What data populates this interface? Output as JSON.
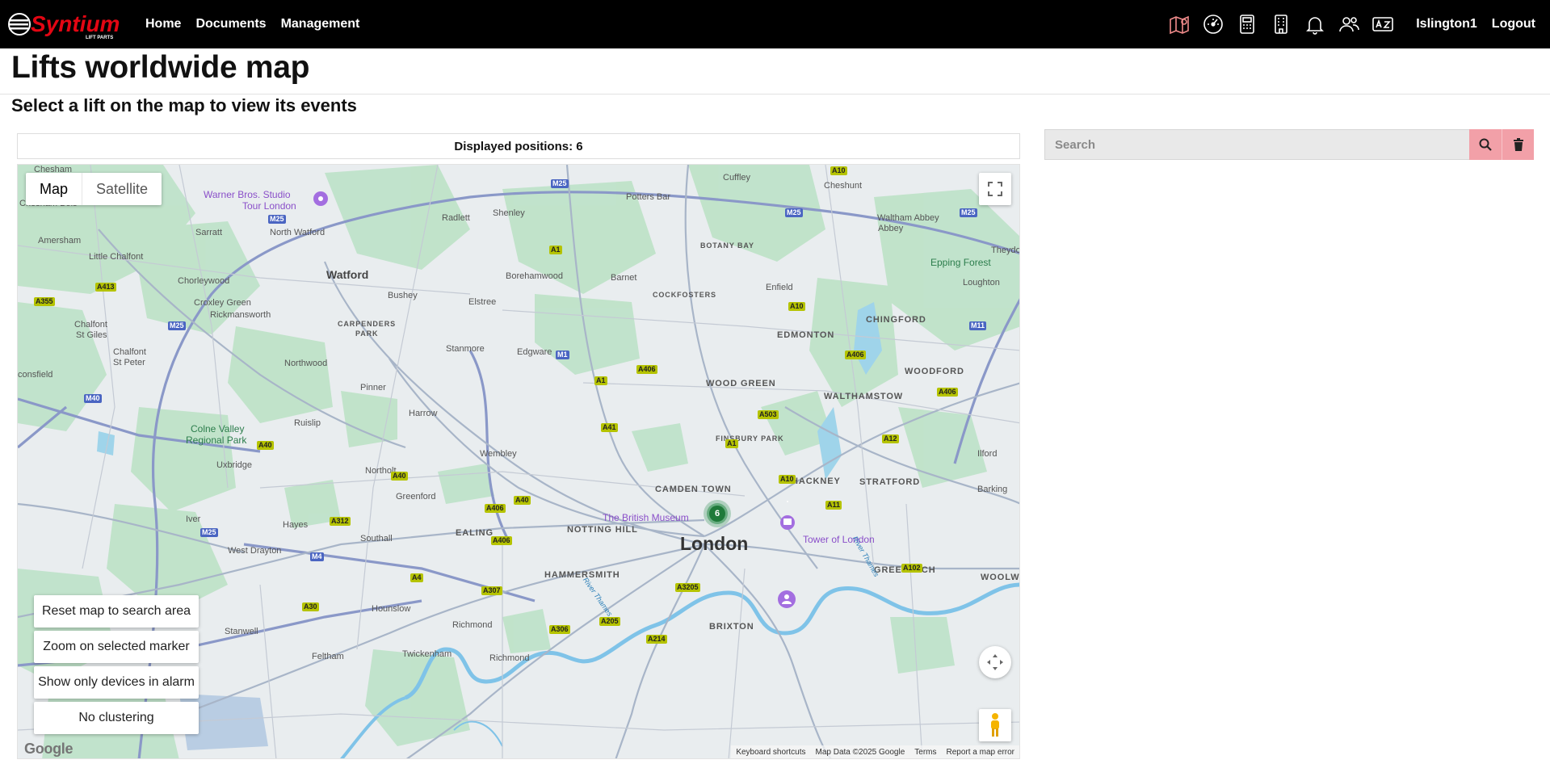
{
  "brand": {
    "name": "Syntium",
    "tagline": "LIFT PARTS",
    "accent": "#e30613"
  },
  "nav": {
    "links": [
      "Home",
      "Documents",
      "Management"
    ],
    "icons": [
      "map-icon",
      "dashboard-icon",
      "calculator-icon",
      "building-icon",
      "bell-icon",
      "users-icon",
      "language-icon"
    ],
    "user": "Islington1",
    "logout": "Logout"
  },
  "page": {
    "title": "Lifts worldwide map",
    "subtitle": "Select a lift on the map to view its events"
  },
  "map": {
    "positions_label": "Displayed positions: 6",
    "type_map": "Map",
    "type_satellite": "Satellite",
    "buttons": {
      "reset": "Reset map to search area",
      "zoom": "Zoom on selected marker",
      "alarm": "Show only devices in alarm",
      "clustering": "No clustering"
    },
    "cluster_count": "6",
    "google": "Google",
    "attribution": {
      "shortcuts": "Keyboard shortcuts",
      "data": "Map Data ©2025 Google",
      "terms": "Terms",
      "report": "Report a map error"
    },
    "labels": {
      "chesham": "Chesham",
      "chesham_bois": "Chesham Bois",
      "warner": "Warner Bros. Studio",
      "warner2": "Tour London",
      "sarratt": "Sarratt",
      "amersham": "Amersham",
      "little_chalfont": "Little Chalfont",
      "chorleywood": "Chorleywood",
      "croxley": "Croxley Green",
      "rickmansworth": "Rickmansworth",
      "chalfont_giles": "Chalfont\nSt Giles",
      "chalfont_peter": "Chalfont\nSt Peter",
      "consfield": "consfield",
      "north_watford": "North Watford",
      "watford": "Watford",
      "radlett": "Radlett",
      "shenley": "Shenley",
      "potters_bar": "Potters Bar",
      "cuffley": "Cuffley",
      "cheshunt": "Cheshunt",
      "waltham_abbey": "Waltham\nAbbey",
      "theydon": "Theydo",
      "botany_bay": "BOTANY BAY",
      "epping_forest": "Epping Forest",
      "loughton": "Loughton",
      "borehamwood": "Borehamwood",
      "barnet": "Barnet",
      "cockfosters": "COCKFOSTERS",
      "enfield": "Enfield",
      "bushey": "Bushey",
      "elstree": "Elstree",
      "carpenders": "CARPENDERS\nPARK",
      "edmonton": "EDMONTON",
      "chingford": "CHINGFORD",
      "stanmore": "Stanmore",
      "edgware": "Edgware",
      "northwood": "Northwood",
      "woodford": "WOODFORD",
      "wood_green": "WOOD GREEN",
      "walthamstow": "WALTHAMSTOW",
      "pinner": "Pinner",
      "harrow": "Harrow",
      "ruislip": "Ruislip",
      "colne_valley": "Colne Valley\nRegional Park",
      "finsbury_park": "FINSBURY PARK",
      "wembley": "Wembley",
      "ilford": "Ilford",
      "uxbridge": "Uxbridge",
      "northolt": "Northolt",
      "hackney": "HACKNEY",
      "stratford": "STRATFORD",
      "camden": "CAMDEN TOWN",
      "barking": "Barking",
      "greenford": "Greenford",
      "british_museum": "The British Museum",
      "iver": "Iver",
      "hayes": "Hayes",
      "ealing": "EALING",
      "notting_hill": "NOTTING HILL",
      "tower": "Tower of London",
      "southall": "Southall",
      "london": "London",
      "west_drayton": "West Drayton",
      "greenwich": "GREENWICH",
      "woolwich": "WOOLWICH",
      "hammersmith": "HAMMERSMITH",
      "hounslow": "Hounslow",
      "richmond": "Richmond",
      "brixton": "BRIXTON",
      "stanwell": "Stanwell",
      "twickenham": "Twickenham",
      "feltham": "Feltham",
      "richmond2": "Richmond",
      "thames": "River Thames",
      "thames2": "River Thames"
    },
    "roads": {
      "m25a": "M25",
      "m25b": "M25",
      "m25c": "M25",
      "m25d": "M25",
      "m25e": "M25",
      "m25f": "M25",
      "a10a": "A10",
      "a10b": "A10",
      "a10c": "A10",
      "a1a": "A1",
      "a1b": "A1",
      "a1c": "A1",
      "a413": "A413",
      "a355": "A355",
      "m11": "M11",
      "a406a": "A406",
      "a406b": "A406",
      "a406c": "A406",
      "a406d": "A406",
      "a406e": "A406",
      "m1": "M1",
      "m40": "M40",
      "a503": "A503",
      "a41": "A41",
      "a12": "A12",
      "a40a": "A40",
      "a40b": "A40",
      "a40c": "A40",
      "a11": "A11",
      "a312": "A312",
      "m4": "M4",
      "a4": "A4",
      "a307": "A307",
      "a3205": "A3205",
      "a102": "A102",
      "a30": "A30",
      "a306": "A306",
      "a205": "A205",
      "a214": "A214"
    }
  },
  "search": {
    "placeholder": "Search"
  }
}
